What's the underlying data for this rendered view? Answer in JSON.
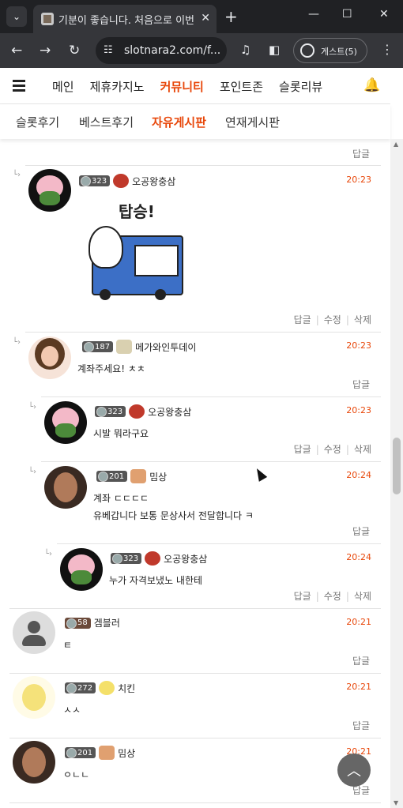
{
  "browser": {
    "tab_title": "기분이 좋습니다. 처음으로 이번",
    "url": "slotnara2.com/f...",
    "profile_label": "게스트(5)"
  },
  "site": {
    "main_nav": [
      "메인",
      "제휴카지노",
      "커뮤니티",
      "포인트존",
      "슬롯리뷰"
    ],
    "main_nav_active": "커뮤니티",
    "sub_nav": [
      "슬롯후기",
      "베스트후기",
      "자유게시판",
      "연재게시판"
    ],
    "sub_nav_active": "자유게시판"
  },
  "labels": {
    "reply": "답글",
    "edit": "수정",
    "delete": "삭제"
  },
  "comments": [
    {
      "nick": "오공왕충삼",
      "level": "323",
      "time": "20:23",
      "text": "",
      "image_text": "탑승!",
      "has_edit": true
    },
    {
      "nick": "메가와인투데이",
      "level": "187",
      "time": "20:23",
      "text": "계좌주세요! ㅊㅊ",
      "has_edit": false
    },
    {
      "nick": "오공왕충삼",
      "level": "323",
      "time": "20:23",
      "text": "시발 뭐라구요",
      "has_edit": true
    },
    {
      "nick": "밈상",
      "level": "201",
      "time": "20:24",
      "text": "계좌 ㄷㄷㄷㄷ",
      "text2": "유베갑니다 보통 문상사서 전달합니다 ㅋ",
      "has_edit": false
    },
    {
      "nick": "오공왕충삼",
      "level": "323",
      "time": "20:24",
      "text": "누가 자격보냈노 내한테",
      "has_edit": true
    },
    {
      "nick": "겜블러",
      "level": "58",
      "time": "20:21",
      "text": "ㅌ",
      "has_edit": false
    },
    {
      "nick": "치킨",
      "level": "272",
      "time": "20:21",
      "text": "ㅅㅅ",
      "has_edit": false
    },
    {
      "nick": "밈상",
      "level": "201",
      "time": "20:21",
      "text": "ㅇㄴㄴ",
      "has_edit": false
    }
  ],
  "colors": {
    "accent": "#e8470a",
    "chrome_dark": "#202124",
    "chrome_mid": "#35363a"
  }
}
